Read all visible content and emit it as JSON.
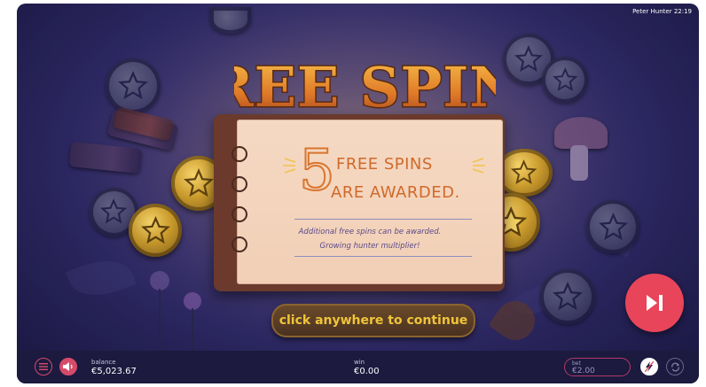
{
  "header": {
    "user": "Peter Hunter",
    "time": "22:19"
  },
  "title": "FREE SPINS",
  "award": {
    "count": "5",
    "line1": "FREE SPINS",
    "line2": "ARE AWARDED.",
    "desc1": "Additional free spins can be awarded.",
    "desc2": "Growing hunter multiplier!"
  },
  "continue_label": "click anywhere to continue",
  "bottom_bar": {
    "balance_label": "balance",
    "balance_value": "€5,023.67",
    "win_label": "win",
    "win_value": "€0.00",
    "bet_label": "bet",
    "bet_value": "€2.00"
  },
  "icons": {
    "menu": "hamburger-icon",
    "sound": "speaker-icon",
    "skip": "skip-forward-icon",
    "turbo": "lightning-icon",
    "autoplay": "autoplay-icon"
  },
  "colors": {
    "background": "#2f2a66",
    "accent": "#e8455a",
    "title_orange": "#d8762e",
    "continue_text": "#f0c43a",
    "bar": "#1c1a3e"
  }
}
